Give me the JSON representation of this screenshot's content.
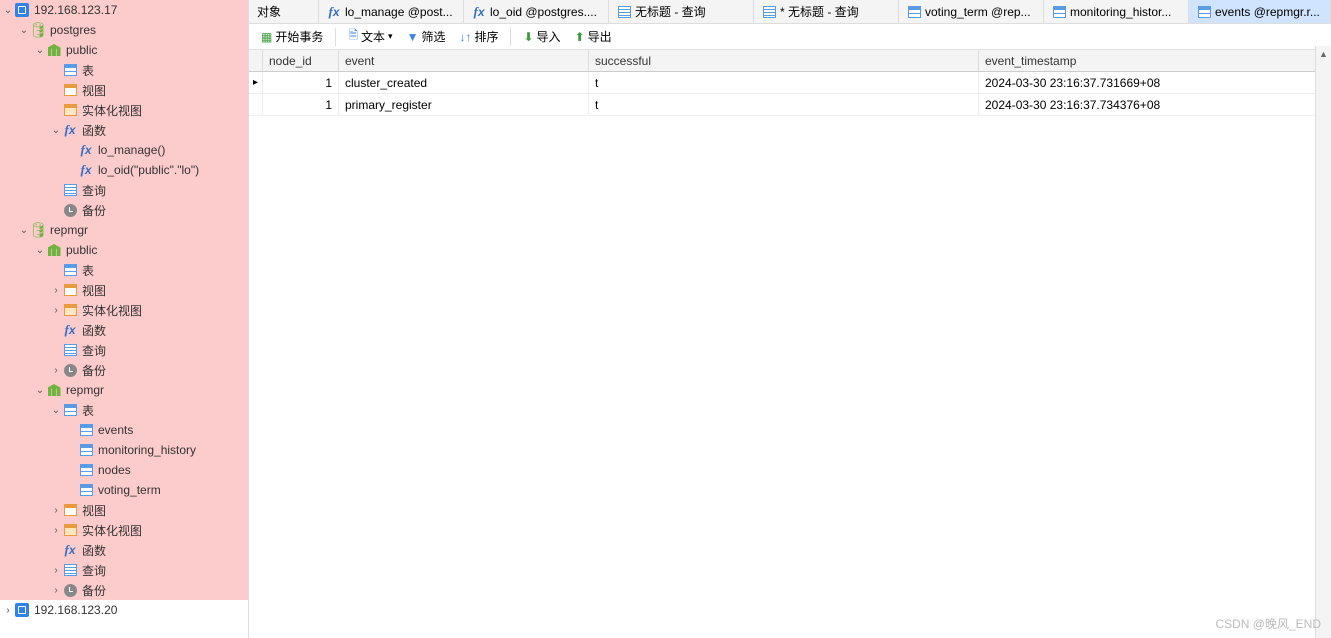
{
  "sidebar": {
    "servers": [
      {
        "name": "192.168.123.17",
        "expanded": true,
        "highlighted": true
      },
      {
        "name": "192.168.123.20",
        "expanded": false,
        "highlighted": false
      }
    ],
    "server1": {
      "db_postgres": {
        "name": "postgres"
      },
      "db_repmgr": {
        "name": "repmgr"
      },
      "schema_public": {
        "name": "public"
      },
      "schema_repmgr": {
        "name": "repmgr"
      },
      "node_table": "表",
      "node_view": "视图",
      "node_matview": "实体化视图",
      "node_function": "函数",
      "node_query": "查询",
      "node_backup": "备份",
      "fn_lo_manage": "lo_manage()",
      "fn_lo_oid": "lo_oid(\"public\".\"lo\")",
      "tables": [
        "events",
        "monitoring_history",
        "nodes",
        "voting_term"
      ]
    }
  },
  "tabs": [
    {
      "type": "text",
      "label": "对象"
    },
    {
      "type": "fx",
      "label": "lo_manage @post..."
    },
    {
      "type": "fx",
      "label": "lo_oid @postgres...."
    },
    {
      "type": "query",
      "label": "无标题 - 查询"
    },
    {
      "type": "query",
      "label": "* 无标题 - 查询"
    },
    {
      "type": "table",
      "label": "voting_term @rep..."
    },
    {
      "type": "table",
      "label": "monitoring_histor..."
    },
    {
      "type": "table",
      "label": "events @repmgr.r...",
      "active": true
    }
  ],
  "toolbar": {
    "begin_tx": "开始事务",
    "text": "文本",
    "filter": "筛选",
    "sort": "排序",
    "import": "导入",
    "export": "导出"
  },
  "grid": {
    "columns": [
      "node_id",
      "event",
      "successful",
      "event_timestamp"
    ],
    "rows": [
      {
        "node_id": "1",
        "event": "cluster_created",
        "successful": "t",
        "event_timestamp": "2024-03-30 23:16:37.731669+08",
        "selected": true
      },
      {
        "node_id": "1",
        "event": "primary_register",
        "successful": "t",
        "event_timestamp": "2024-03-30 23:16:37.734376+08",
        "selected": false
      }
    ]
  },
  "watermark": "CSDN @晚风_END"
}
